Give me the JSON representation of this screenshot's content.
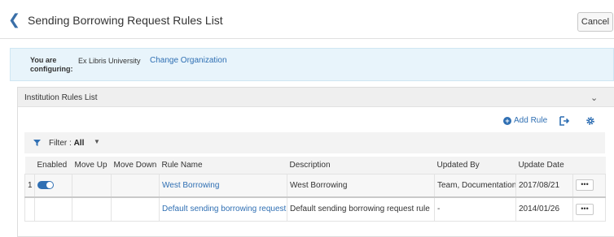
{
  "header": {
    "title": "Sending Borrowing Request Rules List",
    "cancel_label": "Cancel",
    "back_icon": "chevron-left-icon"
  },
  "configuring": {
    "label": "You are\nconfiguring:",
    "organization": "Ex Libris University",
    "change_link": "Change Organization"
  },
  "panel": {
    "title": "Institution Rules List",
    "add_rule_label": "Add Rule",
    "filter_prefix": "Filter : ",
    "filter_value": "All"
  },
  "table": {
    "columns": [
      "",
      "Enabled",
      "Move Up",
      "Move Down",
      "Rule Name",
      "Description",
      "Updated By",
      "Update Date",
      ""
    ],
    "rows": [
      {
        "index": "1",
        "enabled": true,
        "rule_name": "West Borrowing",
        "description": "West Borrowing",
        "updated_by": "Team, Documentation",
        "update_date": "2017/08/21",
        "actions_label": "•••"
      },
      {
        "index": "",
        "enabled": null,
        "rule_name": "Default sending borrowing request rule",
        "description": "Default sending borrowing request rule",
        "updated_by": "-",
        "update_date": "2014/01/26",
        "actions_label": "•••"
      }
    ]
  },
  "colors": {
    "accent": "#2f6fb3",
    "config_bar": "#e8f4fb",
    "panel_header": "#efefef"
  }
}
